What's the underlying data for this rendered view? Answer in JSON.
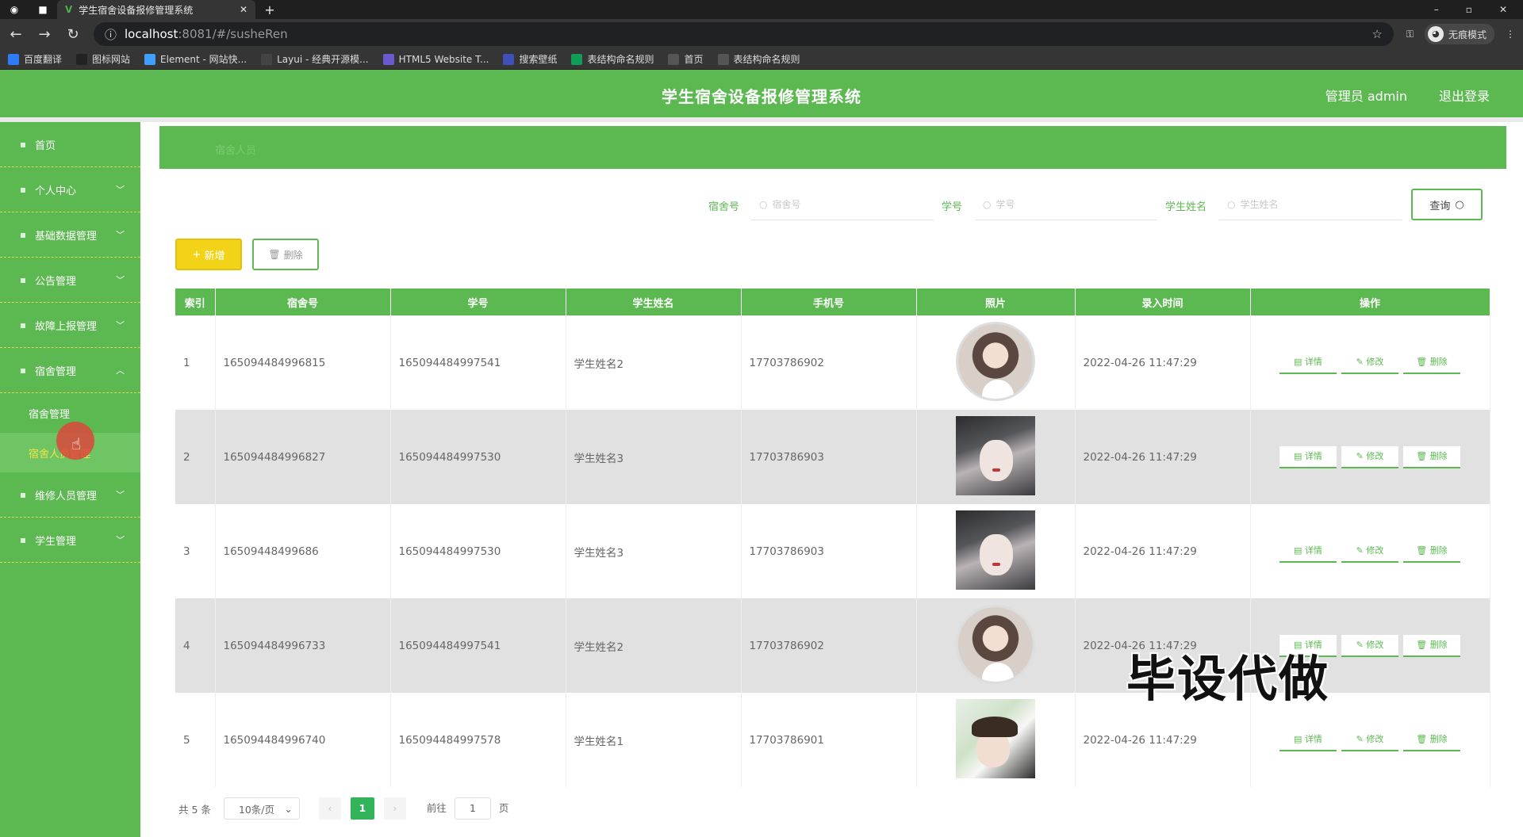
{
  "browser": {
    "tab_title": "学生宿舍设备报修管理系统",
    "url_host": "localhost",
    "url_path": ":8081/#/susheRen",
    "incognito_label": "无痕模式",
    "bookmarks": [
      {
        "label": "百度翻译",
        "color": "#2f7bf6"
      },
      {
        "label": "图标网站",
        "color": "#222222"
      },
      {
        "label": "Element - 网站快...",
        "color": "#409eff"
      },
      {
        "label": "Layui - 经典开源模...",
        "color": "#444444"
      },
      {
        "label": "HTML5 Website T...",
        "color": "#6a5acd"
      },
      {
        "label": "搜索壁纸",
        "color": "#3f51b5"
      },
      {
        "label": "表结构命名规则",
        "color": "#0f9d58"
      },
      {
        "label": "首页",
        "color": "#555555"
      },
      {
        "label": "表结构命名规则",
        "color": "#555555"
      }
    ]
  },
  "header": {
    "title": "学生宿舍设备报修管理系统",
    "user": "管理员 admin",
    "logout": "退出登录"
  },
  "sidebar": {
    "items": [
      {
        "label": "首页",
        "has_children": false
      },
      {
        "label": "个人中心",
        "has_children": true
      },
      {
        "label": "基础数据管理",
        "has_children": true
      },
      {
        "label": "公告管理",
        "has_children": true
      },
      {
        "label": "故障上报管理",
        "has_children": true
      },
      {
        "label": "宿舍管理",
        "has_children": true,
        "expanded": true
      }
    ],
    "sub_items": [
      {
        "label": "宿舍管理",
        "active": false
      },
      {
        "label": "宿舍人员管理",
        "active": true
      }
    ],
    "items_after": [
      {
        "label": "维修人员管理",
        "has_children": true
      },
      {
        "label": "学生管理",
        "has_children": true
      }
    ]
  },
  "breadcrumb": "宿舍人员",
  "search": {
    "fields": [
      {
        "label": "宿舍号",
        "placeholder": "宿舍号"
      },
      {
        "label": "学号",
        "placeholder": "学号"
      },
      {
        "label": "学生姓名",
        "placeholder": "学生姓名"
      }
    ],
    "query_label": "查询"
  },
  "actions": {
    "add_label": "新增",
    "delete_label": "删除"
  },
  "table": {
    "columns": [
      "索引",
      "宿舍号",
      "学号",
      "学生姓名",
      "手机号",
      "照片",
      "录入时间",
      "操作"
    ],
    "op_labels": {
      "detail": "详情",
      "edit": "修改",
      "delete": "删除"
    },
    "rows": [
      {
        "index": "1",
        "dorm": "165094484996815",
        "student_no": "165094484997541",
        "name": "学生姓名2",
        "phone": "17703786902",
        "photo": "round",
        "time": "2022-04-26 11:47:29"
      },
      {
        "index": "2",
        "dorm": "165094484996827",
        "student_no": "165094484997530",
        "name": "学生姓名3",
        "phone": "17703786903",
        "photo": "sq-dark",
        "time": "2022-04-26 11:47:29"
      },
      {
        "index": "3",
        "dorm": "16509448499686",
        "student_no": "165094484997530",
        "name": "学生姓名3",
        "phone": "17703786903",
        "photo": "sq-dark",
        "time": "2022-04-26 11:47:29"
      },
      {
        "index": "4",
        "dorm": "165094484996733",
        "student_no": "165094484997541",
        "name": "学生姓名2",
        "phone": "17703786902",
        "photo": "round",
        "time": "2022-04-26 11:47:29"
      },
      {
        "index": "5",
        "dorm": "165094484996740",
        "student_no": "165094484997578",
        "name": "学生姓名1",
        "phone": "17703786901",
        "photo": "sq-green",
        "time": "2022-04-26 11:47:29"
      }
    ]
  },
  "pagination": {
    "total": "共 5 条",
    "page_size": "10条/页",
    "current_page": "1",
    "goto_prefix": "前往",
    "goto_value": "1",
    "goto_suffix": "页"
  },
  "watermark": "毕设代做"
}
